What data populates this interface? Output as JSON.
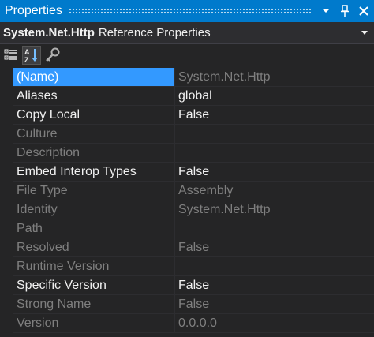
{
  "titlebar": {
    "title": "Properties",
    "accent_color": "#007acc",
    "buttons": [
      "chevron-down-icon",
      "pin-icon",
      "close-icon"
    ]
  },
  "selector": {
    "object_name": "System.Net.Http",
    "object_type": "Reference Properties"
  },
  "toolbar": {
    "tools": [
      "categorized-icon",
      "alphabetical-icon",
      "property-pages-icon"
    ],
    "active_tool": "alphabetical-icon"
  },
  "properties": [
    {
      "name": "(Name)",
      "value": "System.Net.Http",
      "enabled": false,
      "selected": true
    },
    {
      "name": "Aliases",
      "value": "global",
      "enabled": true,
      "selected": false
    },
    {
      "name": "Copy Local",
      "value": "False",
      "enabled": true,
      "selected": false
    },
    {
      "name": "Culture",
      "value": "",
      "enabled": false,
      "selected": false
    },
    {
      "name": "Description",
      "value": "",
      "enabled": false,
      "selected": false
    },
    {
      "name": "Embed Interop Types",
      "value": "False",
      "enabled": true,
      "selected": false
    },
    {
      "name": "File Type",
      "value": "Assembly",
      "enabled": false,
      "selected": false
    },
    {
      "name": "Identity",
      "value": "System.Net.Http",
      "enabled": false,
      "selected": false
    },
    {
      "name": "Path",
      "value": "",
      "enabled": false,
      "selected": false
    },
    {
      "name": "Resolved",
      "value": "False",
      "enabled": false,
      "selected": false
    },
    {
      "name": "Runtime Version",
      "value": "",
      "enabled": false,
      "selected": false
    },
    {
      "name": "Specific Version",
      "value": "False",
      "enabled": true,
      "selected": false
    },
    {
      "name": "Strong Name",
      "value": "False",
      "enabled": false,
      "selected": false
    },
    {
      "name": "Version",
      "value": "0.0.0.0",
      "enabled": false,
      "selected": false
    }
  ]
}
